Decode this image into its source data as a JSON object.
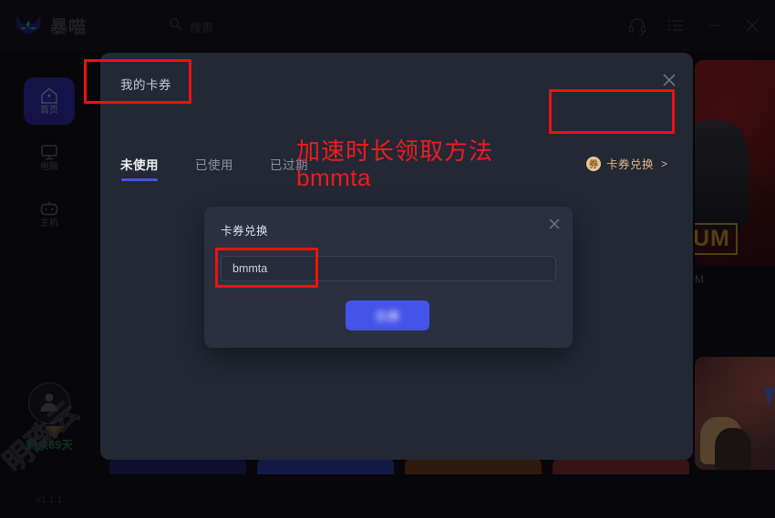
{
  "titlebar": {
    "logo_text": "暴喵",
    "logo_icon": "cat-logo-icon",
    "search_placeholder": "搜索",
    "search_icon": "search-icon",
    "headset_icon": "headset-icon",
    "list_icon": "list-icon",
    "minimize_icon": "minimize-icon",
    "close_icon": "close-icon"
  },
  "sidebar": {
    "items": [
      {
        "label": "首页",
        "icon": "home-icon",
        "active": true
      },
      {
        "label": "电脑",
        "icon": "monitor-icon",
        "active": false
      },
      {
        "label": "主机",
        "icon": "gamepad-icon",
        "active": false
      }
    ],
    "user": {
      "avatar_icon": "user-avatar-icon",
      "crown_icon": "diamond-badge-icon",
      "days_remaining": "剩余69天"
    },
    "watermark": "明珠云",
    "version": "v1.1.1"
  },
  "panel": {
    "title": "我的卡券",
    "close_icon": "close-icon",
    "tabs": [
      {
        "label": "未使用",
        "active": true
      },
      {
        "label": "已使用",
        "active": false
      },
      {
        "label": "已过期",
        "active": false
      }
    ],
    "redeem_link": {
      "coin_glyph": "券",
      "label": "卡券兑换",
      "arrow": ">"
    }
  },
  "annotation": {
    "line1": "加速时长领取方法",
    "line2": "bmmta",
    "color": "#ee1c1c",
    "box_color": "#ee1111"
  },
  "dialog": {
    "title": "卡券兑换",
    "close_icon": "close-icon",
    "input_value": "bmmta",
    "input_placeholder": "",
    "submit_label": "兑换"
  },
  "cards": {
    "card_a_caption": "M",
    "card_a_badge": "UM"
  }
}
